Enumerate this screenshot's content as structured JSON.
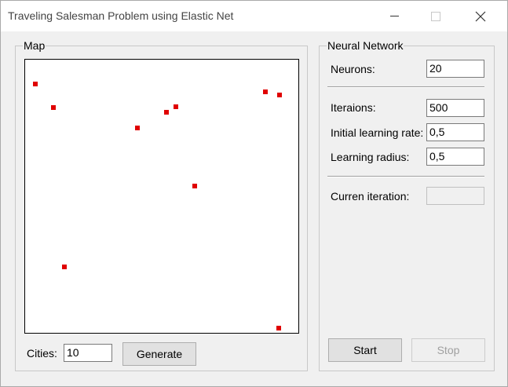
{
  "window": {
    "title": "Traveling Salesman Problem using Elastic Net",
    "controls": {
      "minimize_icon": "minimize-icon",
      "maximize_icon": "maximize-icon",
      "close_icon": "close-icon"
    }
  },
  "map_group": {
    "legend": "Map",
    "cities_label": "Cities:",
    "cities_value": "10",
    "generate_button": "Generate"
  },
  "network_group": {
    "legend": "Neural Network",
    "neurons_label": "Neurons:",
    "neurons_value": "20",
    "iterations_label": "Iteraions:",
    "iterations_value": "500",
    "learning_rate_label": "Initial learning rate:",
    "learning_rate_value": "0,5",
    "learning_radius_label": "Learning radius:",
    "learning_radius_value": "0,5",
    "current_iteration_label": "Curren iteration:",
    "current_iteration_value": "",
    "start_button": "Start",
    "stop_button": "Stop"
  },
  "colors": {
    "city": "#e00000",
    "map_background": "#ffffff",
    "window_background": "#f0f0f0"
  }
}
